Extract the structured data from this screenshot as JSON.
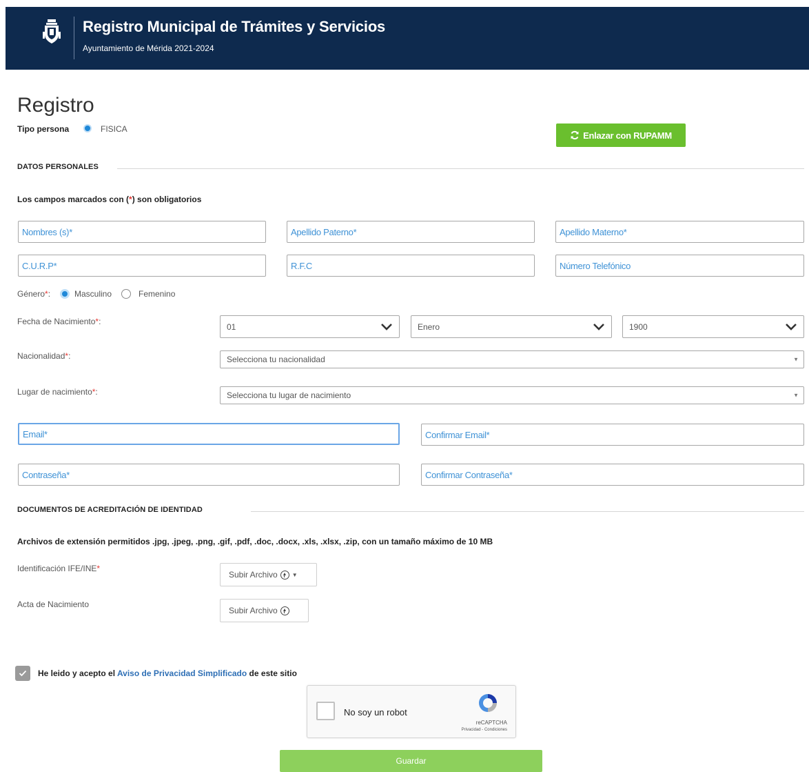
{
  "header": {
    "title": "Registro Municipal de Trámites y Servicios",
    "subtitle": "Ayuntamiento de Mérida 2021-2024"
  },
  "page": {
    "title": "Registro",
    "tipo_label": "Tipo persona",
    "tipo_value": "FISICA",
    "rupamm_button": "Enlazar con RUPAMM"
  },
  "sections": {
    "personal": "DATOS PERSONALES",
    "docs": "DOCUMENTOS DE ACREDITACIÓN DE IDENTIDAD"
  },
  "required_note": {
    "prefix": "Los campos marcados con (",
    "asterisk": "*",
    "suffix": ") son obligatorios"
  },
  "fields": {
    "nombres": "Nombres (s)*",
    "apellido_paterno": "Apellido Paterno*",
    "apellido_materno": "Apellido Materno*",
    "curp": "C.U.R.P*",
    "rfc": "R.F.C",
    "telefono": "Número Telefónico",
    "email": "Email*",
    "confirm_email": "Confirmar Email*",
    "password": "Contraseña*",
    "confirm_password": "Confirmar Contraseña*"
  },
  "gender": {
    "label": "Género",
    "options": [
      "Masculino",
      "Femenino"
    ],
    "selected": "Masculino"
  },
  "birthdate": {
    "label": "Fecha de Nacimiento",
    "day": "01",
    "month": "Enero",
    "year": "1900"
  },
  "nationality": {
    "label": "Nacionalidad",
    "placeholder": "Selecciona tu nacionalidad"
  },
  "birthplace": {
    "label": "Lugar de nacimiento",
    "placeholder": "Selecciona tu lugar de nacimiento"
  },
  "documents": {
    "note": "Archivos de extensión permitidos .jpg, .jpeg, .png, .gif, .pdf, .doc, .docx, .xls, .xlsx, .zip, con un tamaño máximo de 10 MB",
    "ine_label": "Identificación IFE/INE",
    "acta_label": "Acta de Nacimiento",
    "upload_label": "Subir Archivo"
  },
  "privacy": {
    "prefix": "He leido y acepto el ",
    "link": "Aviso de Privacidad Simplificado",
    "suffix": " de este sitio",
    "checked": true
  },
  "captcha": {
    "label": "No soy un robot",
    "brand": "reCAPTCHA",
    "terms": "Privacidad - Condiciones"
  },
  "submit": "Guardar",
  "colors": {
    "header_bg": "#0e2a4e",
    "accent_blue": "#1e88d8",
    "button_green": "#6abf2e",
    "submit_green": "#8dd05c",
    "required_red": "#e53935"
  }
}
